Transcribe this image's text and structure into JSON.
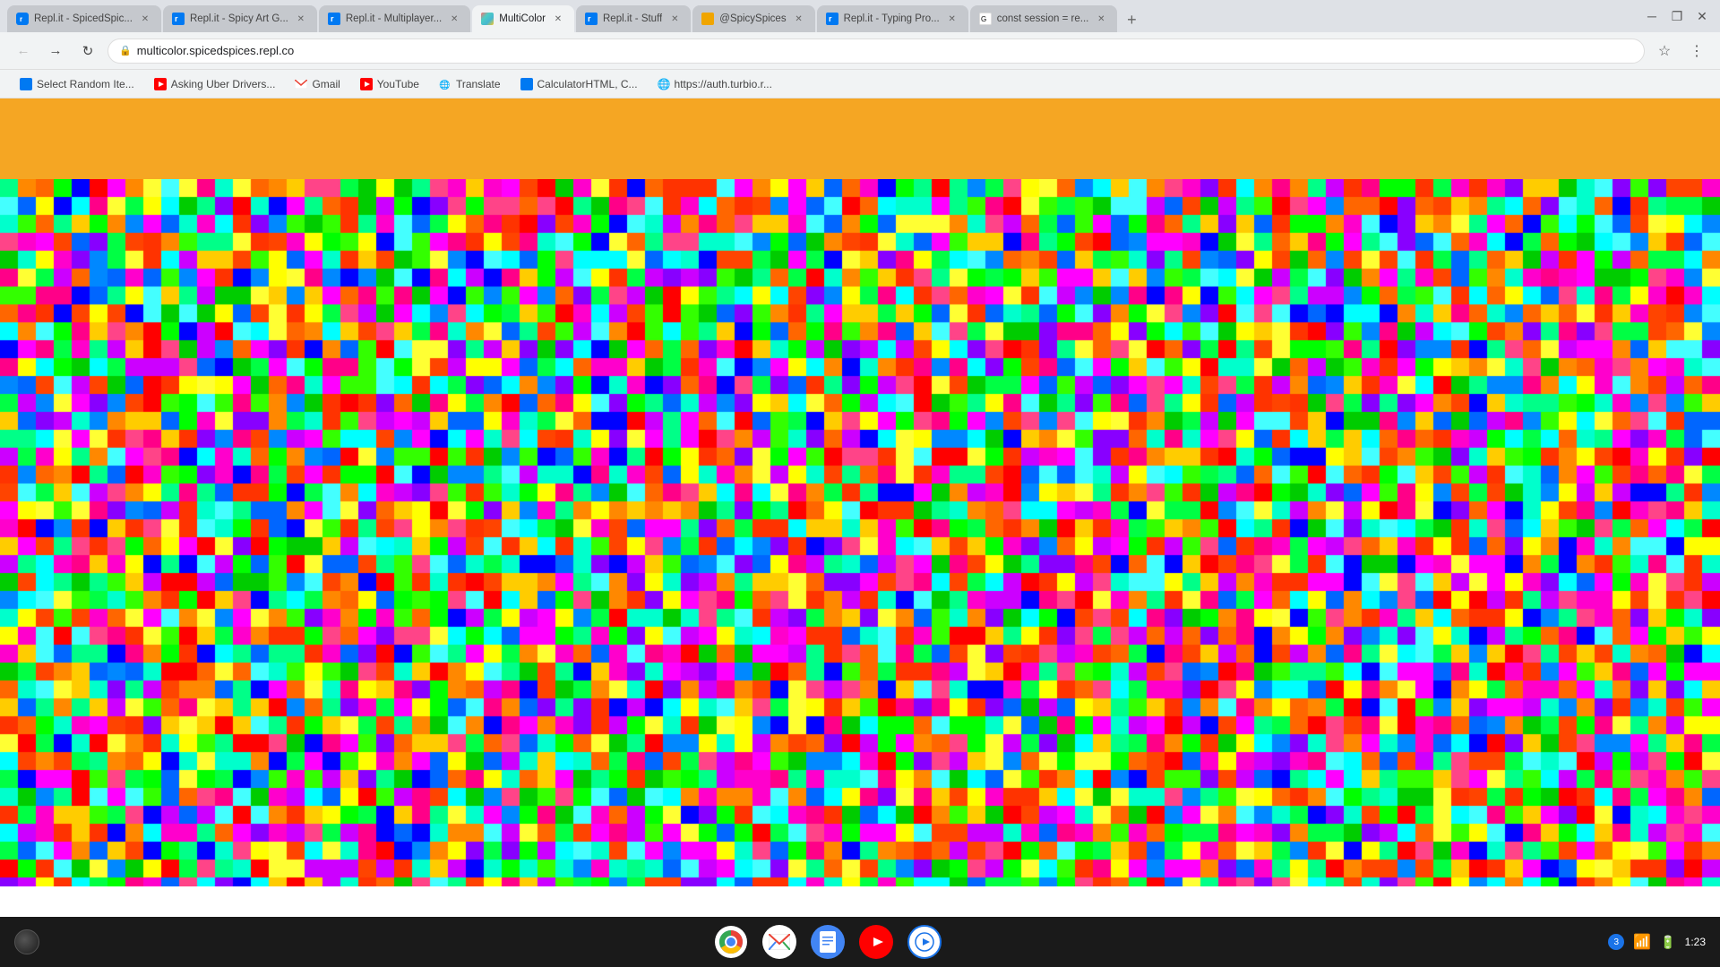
{
  "browser": {
    "title": "MultiColor",
    "url": "multicolor.spicedspices.repl.co",
    "tabs": [
      {
        "id": "tab1",
        "label": "Repl.it - SpicedSpic...",
        "active": false,
        "favicon_type": "replit"
      },
      {
        "id": "tab2",
        "label": "Repl.it - Spicy Art G...",
        "active": false,
        "favicon_type": "replit"
      },
      {
        "id": "tab3",
        "label": "Repl.it - Multiplayer...",
        "active": false,
        "favicon_type": "replit"
      },
      {
        "id": "tab4",
        "label": "MultiColor",
        "active": true,
        "favicon_type": "multicolor"
      },
      {
        "id": "tab5",
        "label": "Repl.it - Stuff",
        "active": false,
        "favicon_type": "replit"
      },
      {
        "id": "tab6",
        "label": "@SpicySpices",
        "active": false,
        "favicon_type": "spicy"
      },
      {
        "id": "tab7",
        "label": "Repl.it - Typing Pro...",
        "active": false,
        "favicon_type": "replit"
      },
      {
        "id": "tab8",
        "label": "const session = re...",
        "active": false,
        "favicon_type": "google"
      }
    ],
    "bookmarks": [
      {
        "label": "Select Random Ite...",
        "favicon_type": "replit"
      },
      {
        "label": "Asking Uber Drivers...",
        "favicon_type": "youtube"
      },
      {
        "label": "Gmail",
        "favicon_type": "gmail"
      },
      {
        "label": "YouTube",
        "favicon_type": "youtube"
      },
      {
        "label": "Translate",
        "favicon_type": "google"
      },
      {
        "label": "CalculatorHTML, C...",
        "favicon_type": "replit"
      },
      {
        "label": "https://auth.turbio.r...",
        "favicon_type": "globe"
      }
    ]
  },
  "page": {
    "orange_header_color": "#f5a623"
  },
  "taskbar": {
    "time": "1:23",
    "notification_count": "3"
  }
}
